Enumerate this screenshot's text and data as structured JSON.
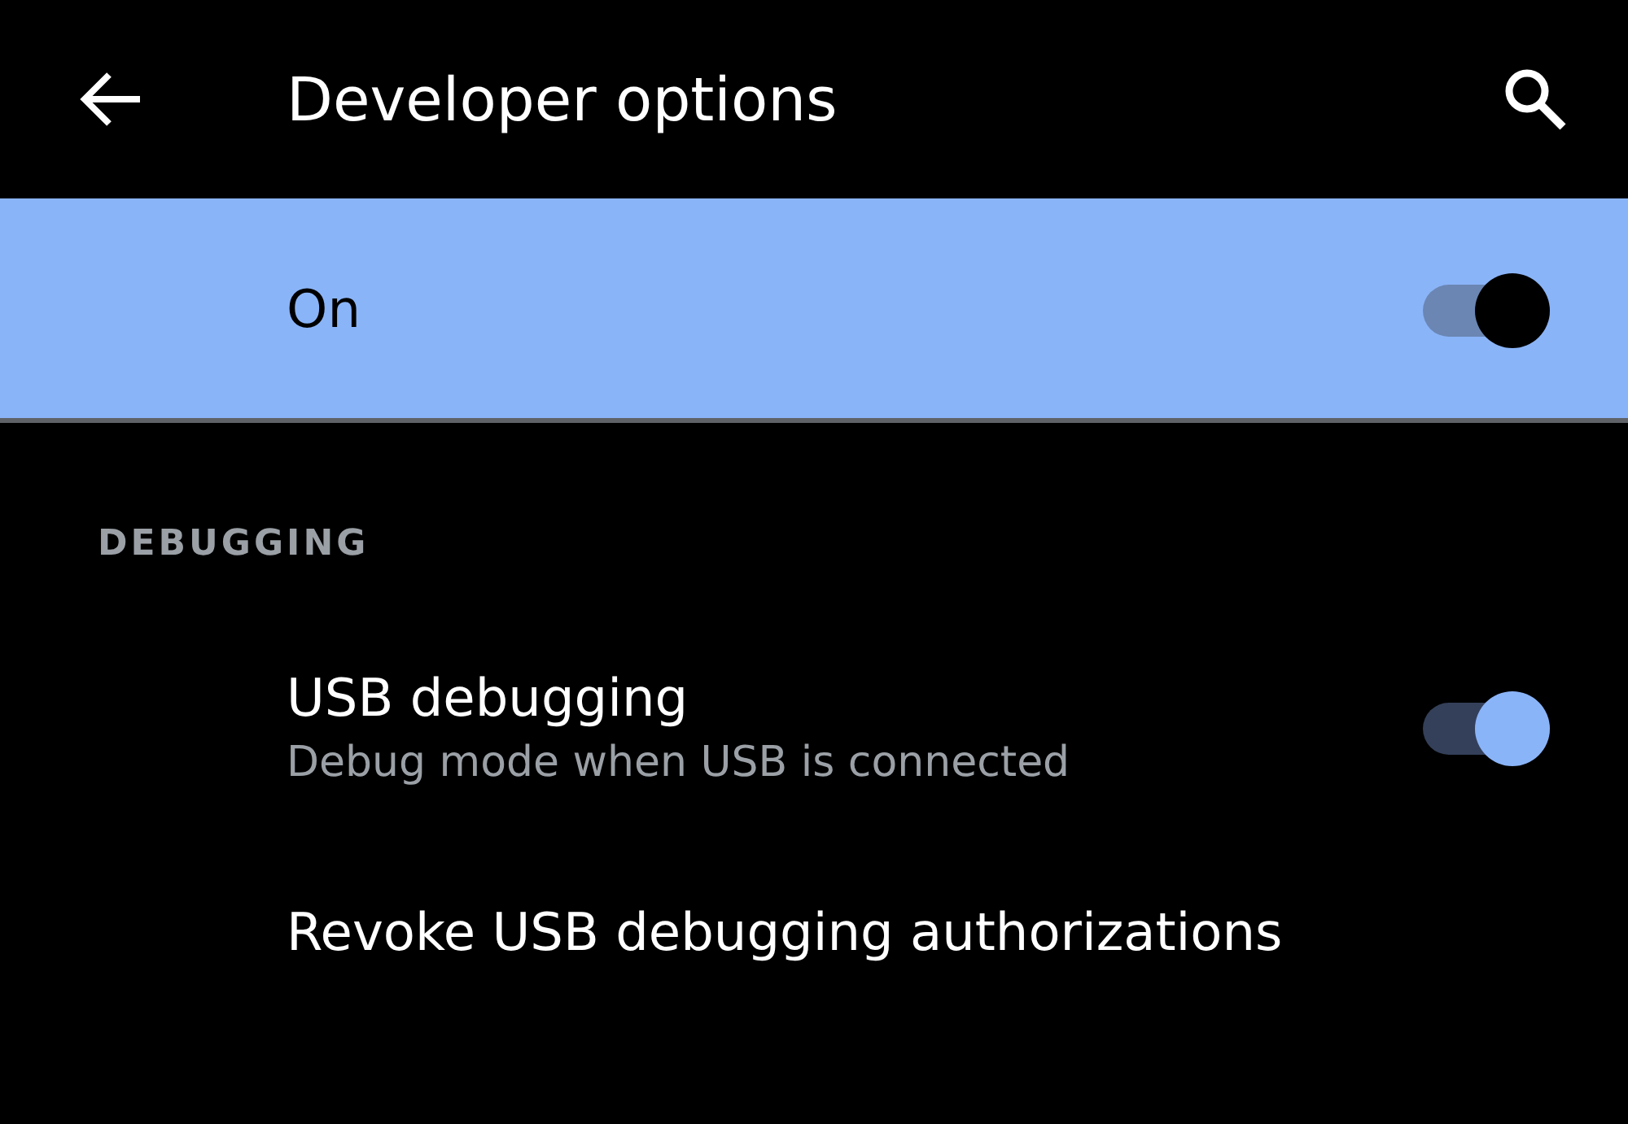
{
  "app_bar": {
    "title": "Developer options"
  },
  "master_switch": {
    "label": "On",
    "checked": true
  },
  "section": {
    "header": "DEBUGGING",
    "items": [
      {
        "kind": "switch",
        "title": "USB debugging",
        "summary": "Debug mode when USB is connected",
        "checked": true
      },
      {
        "kind": "plain",
        "title": "Revoke USB debugging authorizations"
      }
    ]
  }
}
